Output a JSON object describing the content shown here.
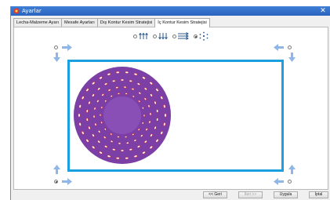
{
  "window": {
    "title": "Ayarlar",
    "close_glyph": "✕"
  },
  "tabs": [
    {
      "label": "Lecha-Malzeme Ayarı",
      "active": false
    },
    {
      "label": "Mesafe Ayarları",
      "active": false
    },
    {
      "label": "Dış Kontur Kesim Stratejisi",
      "active": false
    },
    {
      "label": "İç Kontur Kesim Stratejisi",
      "active": true
    }
  ],
  "strategies": [
    {
      "icon": "vertical-zigzag-up-icon",
      "selected": false
    },
    {
      "icon": "vertical-zigzag-down-icon",
      "selected": false
    },
    {
      "icon": "horizontal-zigzag-icon",
      "selected": false
    },
    {
      "icon": "spiral-dots-icon",
      "selected": true
    }
  ],
  "start_corners": [
    {
      "corner": "top-left",
      "selected": false
    },
    {
      "corner": "top-right",
      "selected": false
    },
    {
      "corner": "bottom-left",
      "selected": true
    },
    {
      "corner": "bottom-right",
      "selected": false
    }
  ],
  "colors": {
    "frame": "#1aa0df",
    "arrow": "#8fb6e6",
    "plate": "#7b3fa6",
    "hole": "#ffffff",
    "hole_accent": "#d12a2a"
  },
  "buttons": {
    "back": "<< Geri",
    "next": "İleri >>",
    "apply": "Uygula",
    "cancel": "İptal"
  }
}
